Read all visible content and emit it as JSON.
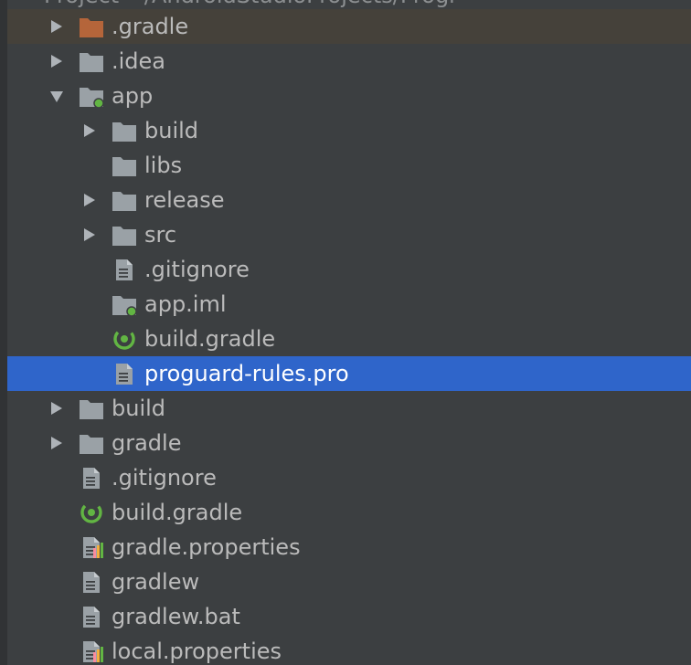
{
  "colors": {
    "background": "#3c3f41",
    "selected_row": "#2f65ca",
    "excluded_row": "#45413a",
    "text": "#bbbbbb",
    "selected_text": "#ffffff",
    "folder": "#9aa1a6",
    "excluded_folder": "#b5653a",
    "module_dot": "#62b543"
  },
  "tree": {
    "clipped_header": "Project  ~/AndroidStudioProjects/Progr",
    "items": [
      {
        "label": ".gradle",
        "depth": 0,
        "icon": "folder-excluded-icon",
        "expandable": true,
        "expanded": false,
        "selected": false
      },
      {
        "label": ".idea",
        "depth": 0,
        "icon": "folder-icon",
        "expandable": true,
        "expanded": false,
        "selected": false
      },
      {
        "label": "app",
        "depth": 0,
        "icon": "module-folder-icon",
        "expandable": true,
        "expanded": true,
        "selected": false
      },
      {
        "label": "build",
        "depth": 1,
        "icon": "folder-icon",
        "expandable": true,
        "expanded": false,
        "selected": false
      },
      {
        "label": "libs",
        "depth": 1,
        "icon": "folder-icon",
        "expandable": false,
        "expanded": false,
        "selected": false
      },
      {
        "label": "release",
        "depth": 1,
        "icon": "folder-icon",
        "expandable": true,
        "expanded": false,
        "selected": false
      },
      {
        "label": "src",
        "depth": 1,
        "icon": "folder-icon",
        "expandable": true,
        "expanded": false,
        "selected": false
      },
      {
        "label": ".gitignore",
        "depth": 1,
        "icon": "text-file-icon",
        "expandable": false,
        "expanded": false,
        "selected": false
      },
      {
        "label": "app.iml",
        "depth": 1,
        "icon": "module-file-icon",
        "expandable": false,
        "expanded": false,
        "selected": false
      },
      {
        "label": "build.gradle",
        "depth": 1,
        "icon": "gradle-icon",
        "expandable": false,
        "expanded": false,
        "selected": false
      },
      {
        "label": "proguard-rules.pro",
        "depth": 1,
        "icon": "text-file-icon",
        "expandable": false,
        "expanded": false,
        "selected": true
      },
      {
        "label": "build",
        "depth": 0,
        "icon": "folder-icon",
        "expandable": true,
        "expanded": false,
        "selected": false
      },
      {
        "label": "gradle",
        "depth": 0,
        "icon": "folder-icon",
        "expandable": true,
        "expanded": false,
        "selected": false
      },
      {
        "label": ".gitignore",
        "depth": 0,
        "icon": "text-file-icon",
        "expandable": false,
        "expanded": false,
        "selected": false
      },
      {
        "label": "build.gradle",
        "depth": 0,
        "icon": "gradle-icon",
        "expandable": false,
        "expanded": false,
        "selected": false
      },
      {
        "label": "gradle.properties",
        "depth": 0,
        "icon": "properties-file-icon",
        "expandable": false,
        "expanded": false,
        "selected": false
      },
      {
        "label": "gradlew",
        "depth": 0,
        "icon": "text-file-icon",
        "expandable": false,
        "expanded": false,
        "selected": false
      },
      {
        "label": "gradlew.bat",
        "depth": 0,
        "icon": "text-file-icon",
        "expandable": false,
        "expanded": false,
        "selected": false
      },
      {
        "label": "local.properties",
        "depth": 0,
        "icon": "properties-file-icon",
        "expandable": false,
        "expanded": false,
        "selected": false
      }
    ]
  }
}
